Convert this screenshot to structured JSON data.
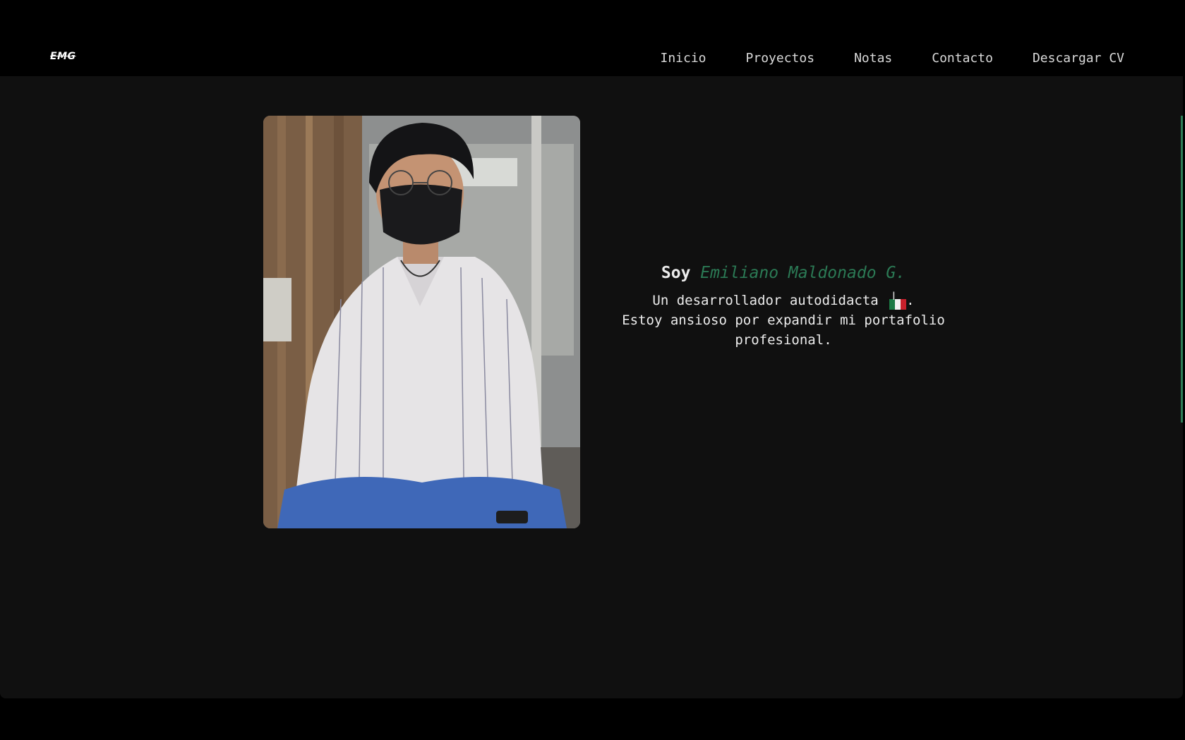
{
  "header": {
    "logo": "EMG",
    "nav": [
      {
        "label": "Inicio"
      },
      {
        "label": "Proyectos"
      },
      {
        "label": "Notas"
      },
      {
        "label": "Contacto"
      },
      {
        "label": "Descargar CV"
      }
    ]
  },
  "hero": {
    "greeting": "Soy ",
    "name": "Emiliano Maldonado G.",
    "line1": "Un desarrollador autodidacta ",
    "line1_end": ".",
    "line2": "Estoy ansioso por expandir mi portafolio",
    "line3": "profesional.",
    "flag": "flag-mexico-icon"
  },
  "colors": {
    "accent": "#2b7a55",
    "background": "#101010",
    "navbar": "#000000",
    "text": "#ececec"
  }
}
